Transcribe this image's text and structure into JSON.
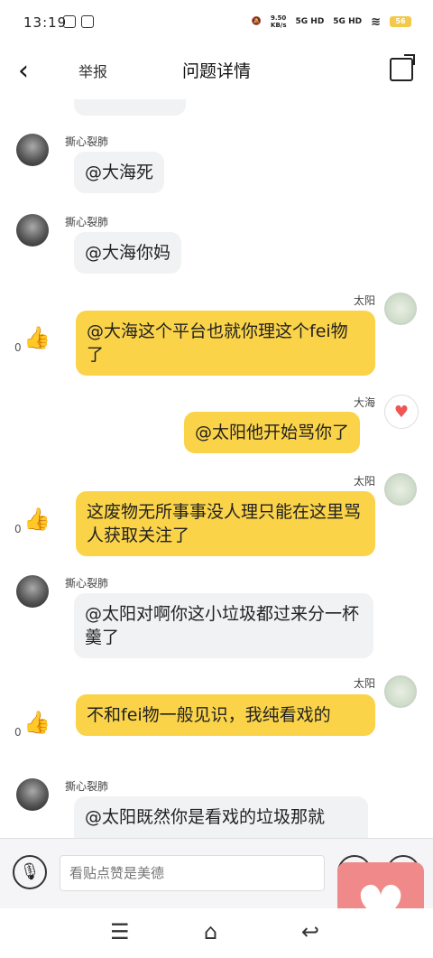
{
  "status": {
    "time": "13:19",
    "battery": "56",
    "speed": "9.50\nKB/s",
    "net1": "5G HD",
    "net2": "5G HD"
  },
  "nav": {
    "back": "‹",
    "report": "举报",
    "title": "问题详情",
    "share_icon": "share-icon"
  },
  "messages": [
    {
      "side": "left",
      "name": "撕心裂肺",
      "text": "@大海死"
    },
    {
      "side": "left",
      "name": "撕心裂肺",
      "text": "@大海你妈"
    },
    {
      "side": "right",
      "name": "太阳",
      "text": "@大海这个平台也就你理这个fei物了",
      "likes": "0"
    },
    {
      "side": "right",
      "name": "大海",
      "text": "@太阳他开始骂你了"
    },
    {
      "side": "right",
      "name": "太阳",
      "text": "这废物无所事事没人理只能在这里骂人获取关注了",
      "likes": "0"
    },
    {
      "side": "left",
      "name": "撕心裂肺",
      "text": "@太阳对啊你这小垃圾都过来分一杯羹了"
    },
    {
      "side": "right",
      "name": "太阳",
      "text": "不和fei物一般见识，我纯看戏的",
      "likes": "0"
    },
    {
      "side": "left",
      "name": "撕心裂肺",
      "text": "@太阳既然你是看戏的垃圾那就"
    }
  ],
  "input": {
    "placeholder": "看贴点赞是美德"
  },
  "colors": {
    "right_bubble": "#fad349",
    "left_bubble": "#f1f2f4",
    "floating_btn": "#f08a8a"
  }
}
